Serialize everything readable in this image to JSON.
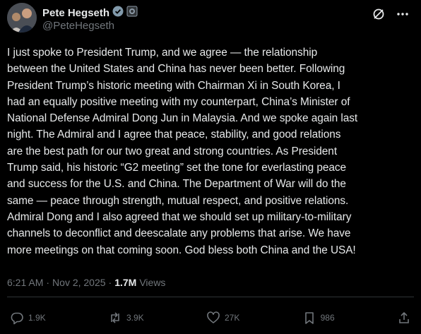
{
  "author": {
    "name": "Pete Hegseth",
    "handle": "@PeteHegseth"
  },
  "post": {
    "text": "I just spoke to President Trump, and we agree — the relationship\nbetween the United States and China has never been better. Following\nPresident Trump’s historic meeting with Chairman Xi in South Korea, I\nhad an equally positive meeting with my counterpart, China’s Minister of\nNational Defense Admiral Dong Jun in Malaysia. And we spoke again last\nnight. The Admiral and I agree that peace, stability, and good relations\nare the best path for our two great and strong countries. As President\nTrump said, his historic “G2 meeting” set the tone for everlasting peace\nand success for the U.S. and China. The Department of War will do the\nsame — peace through strength, mutual respect, and positive relations.\nAdmiral Dong and I also agreed that we should set up military-to-military\nchannels to deconflict and deescalate any problems that arise. We have\nmore meetings on that coming soon. God bless both China and the USA!",
    "time": "6:21 AM",
    "separator": "·",
    "date": "Nov 2, 2025",
    "views_count": "1.7M",
    "views_label": "Views"
  },
  "actions": {
    "replies": "1.9K",
    "reposts": "3.9K",
    "likes": "27K",
    "bookmarks": "986"
  },
  "colors": {
    "background": "#000000",
    "text": "#e7e9ea",
    "muted": "#71767b",
    "verified_badge": "#829aab"
  },
  "icons": {
    "verified": "verified-badge-icon",
    "affiliate": "affiliate-badge-icon",
    "grok": "grok-icon",
    "more": "more-icon",
    "reply": "reply-icon",
    "repost": "repost-icon",
    "like": "like-icon",
    "bookmark": "bookmark-icon",
    "share": "share-icon"
  }
}
